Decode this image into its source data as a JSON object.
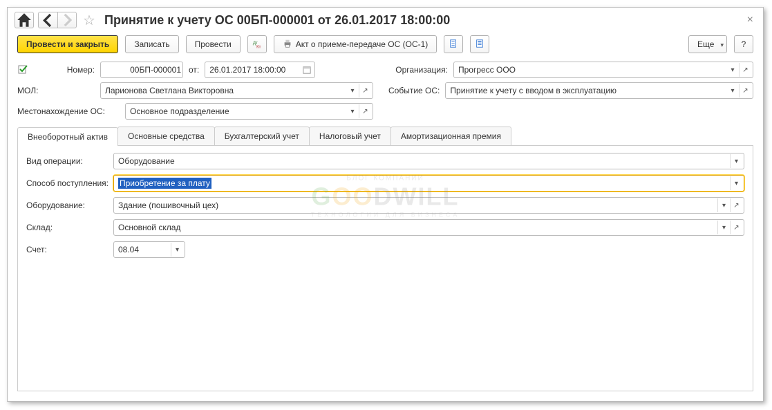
{
  "title": "Принятие к учету ОС 00БП-000001 от 26.01.2017 18:00:00",
  "toolbar": {
    "post_close": "Провести и закрыть",
    "save": "Записать",
    "post": "Провести",
    "act": "Акт о приеме-передаче ОС (ОС-1)",
    "more": "Еще",
    "help": "?"
  },
  "fields": {
    "number_label": "Номер:",
    "number_value": "00БП-000001",
    "from_label": "от:",
    "date_value": "26.01.2017 18:00:00",
    "org_label": "Организация:",
    "org_value": "Прогресс ООО",
    "mol_label": "МОЛ:",
    "mol_value": "Ларионова Светлана Викторовна",
    "event_label": "Событие ОС:",
    "event_value": "Принятие к учету с вводом в эксплуатацию",
    "location_label": "Местонахождение ОС:",
    "location_value": "Основное подразделение"
  },
  "tabs": {
    "t1": "Внеоборотный актив",
    "t2": "Основные средства",
    "t3": "Бухгалтерский учет",
    "t4": "Налоговый учет",
    "t5": "Амортизационная премия"
  },
  "panel": {
    "op_label": "Вид операции:",
    "op_value": "Оборудование",
    "method_label": "Способ поступления:",
    "method_value": "Приобретение за плату",
    "equip_label": "Оборудование:",
    "equip_value": "Здание (пошивочный цех)",
    "wh_label": "Склад:",
    "wh_value": "Основной склад",
    "acc_label": "Счет:",
    "acc_value": "08.04"
  },
  "watermark": {
    "l1": "БЛОГ КОМПАНИИ",
    "l3": "ТЕХНОЛОГИИ ДЛЯ БИЗНЕСА"
  }
}
